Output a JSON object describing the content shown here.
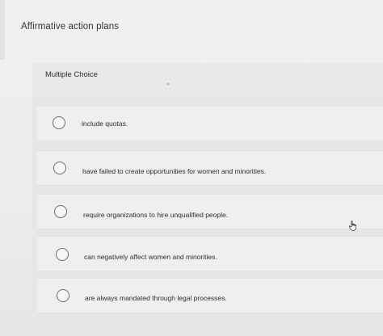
{
  "question": {
    "text": "Affirmative action plans",
    "type_label": "Multiple Choice"
  },
  "options": [
    {
      "label": "include quotas."
    },
    {
      "label": "have failed to create opportunities for women and minorities."
    },
    {
      "label": "require organizations to hire unqualified people."
    },
    {
      "label": "can negatively affect women and minorities."
    },
    {
      "label": "are always mandated through legal processes."
    }
  ],
  "icons": {
    "radio": "radio-circle-icon",
    "cursor": "hand-pointer-icon"
  }
}
